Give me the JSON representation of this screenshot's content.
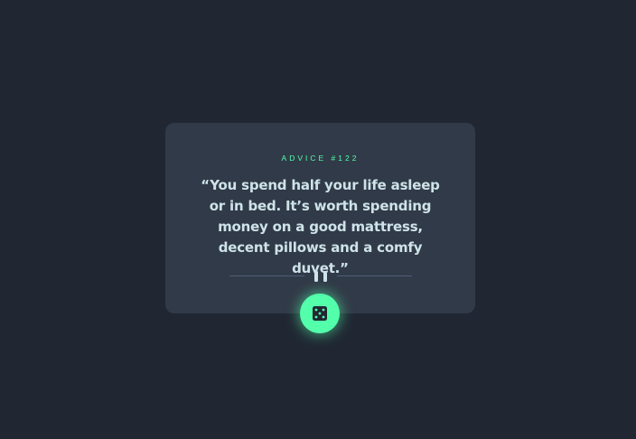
{
  "advice": {
    "label": "ADVICE #122",
    "quote": "“You spend half your life asleep or in bed. It’s worth spending money on a good mattress, decent pillows and a comfy duvet.”"
  },
  "divider": {
    "icon": "pause-icon"
  },
  "action": {
    "icon": "dice-icon"
  },
  "colors": {
    "background": "#202733",
    "card": "#313a48",
    "accent": "#53ffaa",
    "text": "#cee3e9",
    "divider": "#4f5d74"
  }
}
